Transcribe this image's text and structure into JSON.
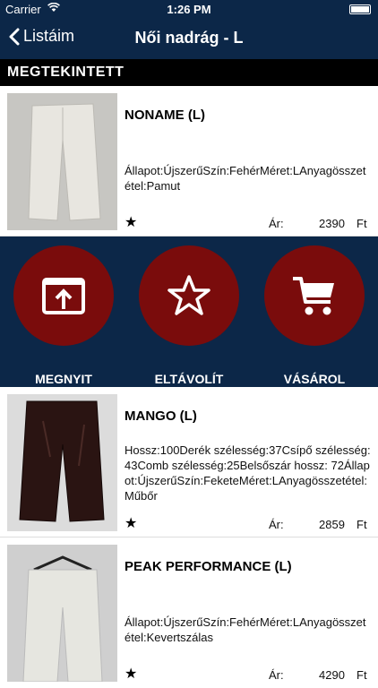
{
  "status": {
    "carrier": "Carrier",
    "time": "1:26 PM"
  },
  "nav": {
    "back_label": "Listáim",
    "title": "Női nadrág - L"
  },
  "section": {
    "title": "MEGTEKINTETT"
  },
  "products": [
    {
      "name": "NONAME (L)",
      "description": "Állapot:ÚjszerűSzín:FehérMéret:LAnyagösszetétel:Pamut",
      "price_label": "Ár:",
      "price": "2390",
      "currency": "Ft"
    },
    {
      "name": "MANGO (L)",
      "description": "Hossz:100Derék szélesség:37Csípő szélesség:43Comb szélesség:25Belsőszár hossz: 72Állapot:ÚjszerűSzín:FeketeMéret:LAnyagösszetétel:Műbőr",
      "price_label": "Ár:",
      "price": "2859",
      "currency": "Ft"
    },
    {
      "name": "PEAK PERFORMANCE (L)",
      "description": "Állapot:ÚjszerűSzín:FehérMéret:LAnyagösszetétel:Kevertszálas",
      "price_label": "Ár:",
      "price": "4290",
      "currency": "Ft"
    }
  ],
  "actions": {
    "open": "MEGNYIT",
    "remove": "ELTÁVOLÍT",
    "buy": "VÁSÁROL"
  },
  "colors": {
    "navy": "#0c2748",
    "maroon": "#7a0c0c"
  }
}
